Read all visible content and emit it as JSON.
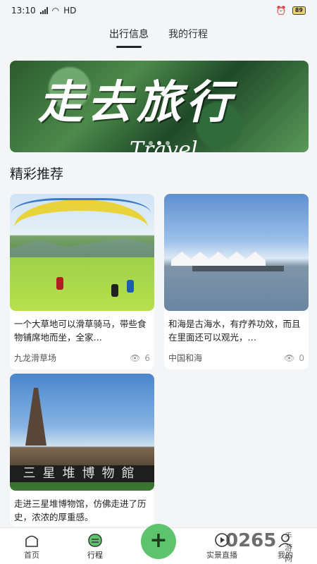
{
  "status": {
    "time": "13:10",
    "network": "HD",
    "battery": "89"
  },
  "tabs": [
    {
      "label": "出行信息",
      "active": true
    },
    {
      "label": "我的行程",
      "active": false
    }
  ],
  "banner": {
    "title": "走去旅行",
    "subtitle": "Travel",
    "dots": 3,
    "active_dot": 1
  },
  "section": {
    "title": "精彩推荐"
  },
  "cards": [
    {
      "desc": "一个大草地可以滑草骑马，带些食物铺席地而坐，全家…",
      "place": "九龙滑草场",
      "views": "6",
      "image": "paragliding-grassland"
    },
    {
      "desc": "和海是古海水，有疗养功效，而且在里面还可以观光，…",
      "place": "中国和海",
      "views": "0",
      "image": "lakeside-tents"
    },
    {
      "desc": "走进三星堆博物馆，仿佛走进了历史，浓浓的厚重感。",
      "image": "museum",
      "sign_text": "三星堆博物館"
    }
  ],
  "nav": [
    {
      "label": "首页",
      "icon": "home-icon"
    },
    {
      "label": "行程",
      "icon": "itinerary-icon",
      "active": true
    },
    {
      "label": "",
      "icon": "add-icon"
    },
    {
      "label": "实景直播",
      "icon": "live-icon"
    },
    {
      "label": "我的",
      "icon": "profile-icon"
    }
  ],
  "add_symbol": "+",
  "watermark": {
    "text": "0265",
    "sub": "手游网"
  },
  "colors": {
    "accent": "#5dc46d",
    "background": "#f4f5f7"
  }
}
